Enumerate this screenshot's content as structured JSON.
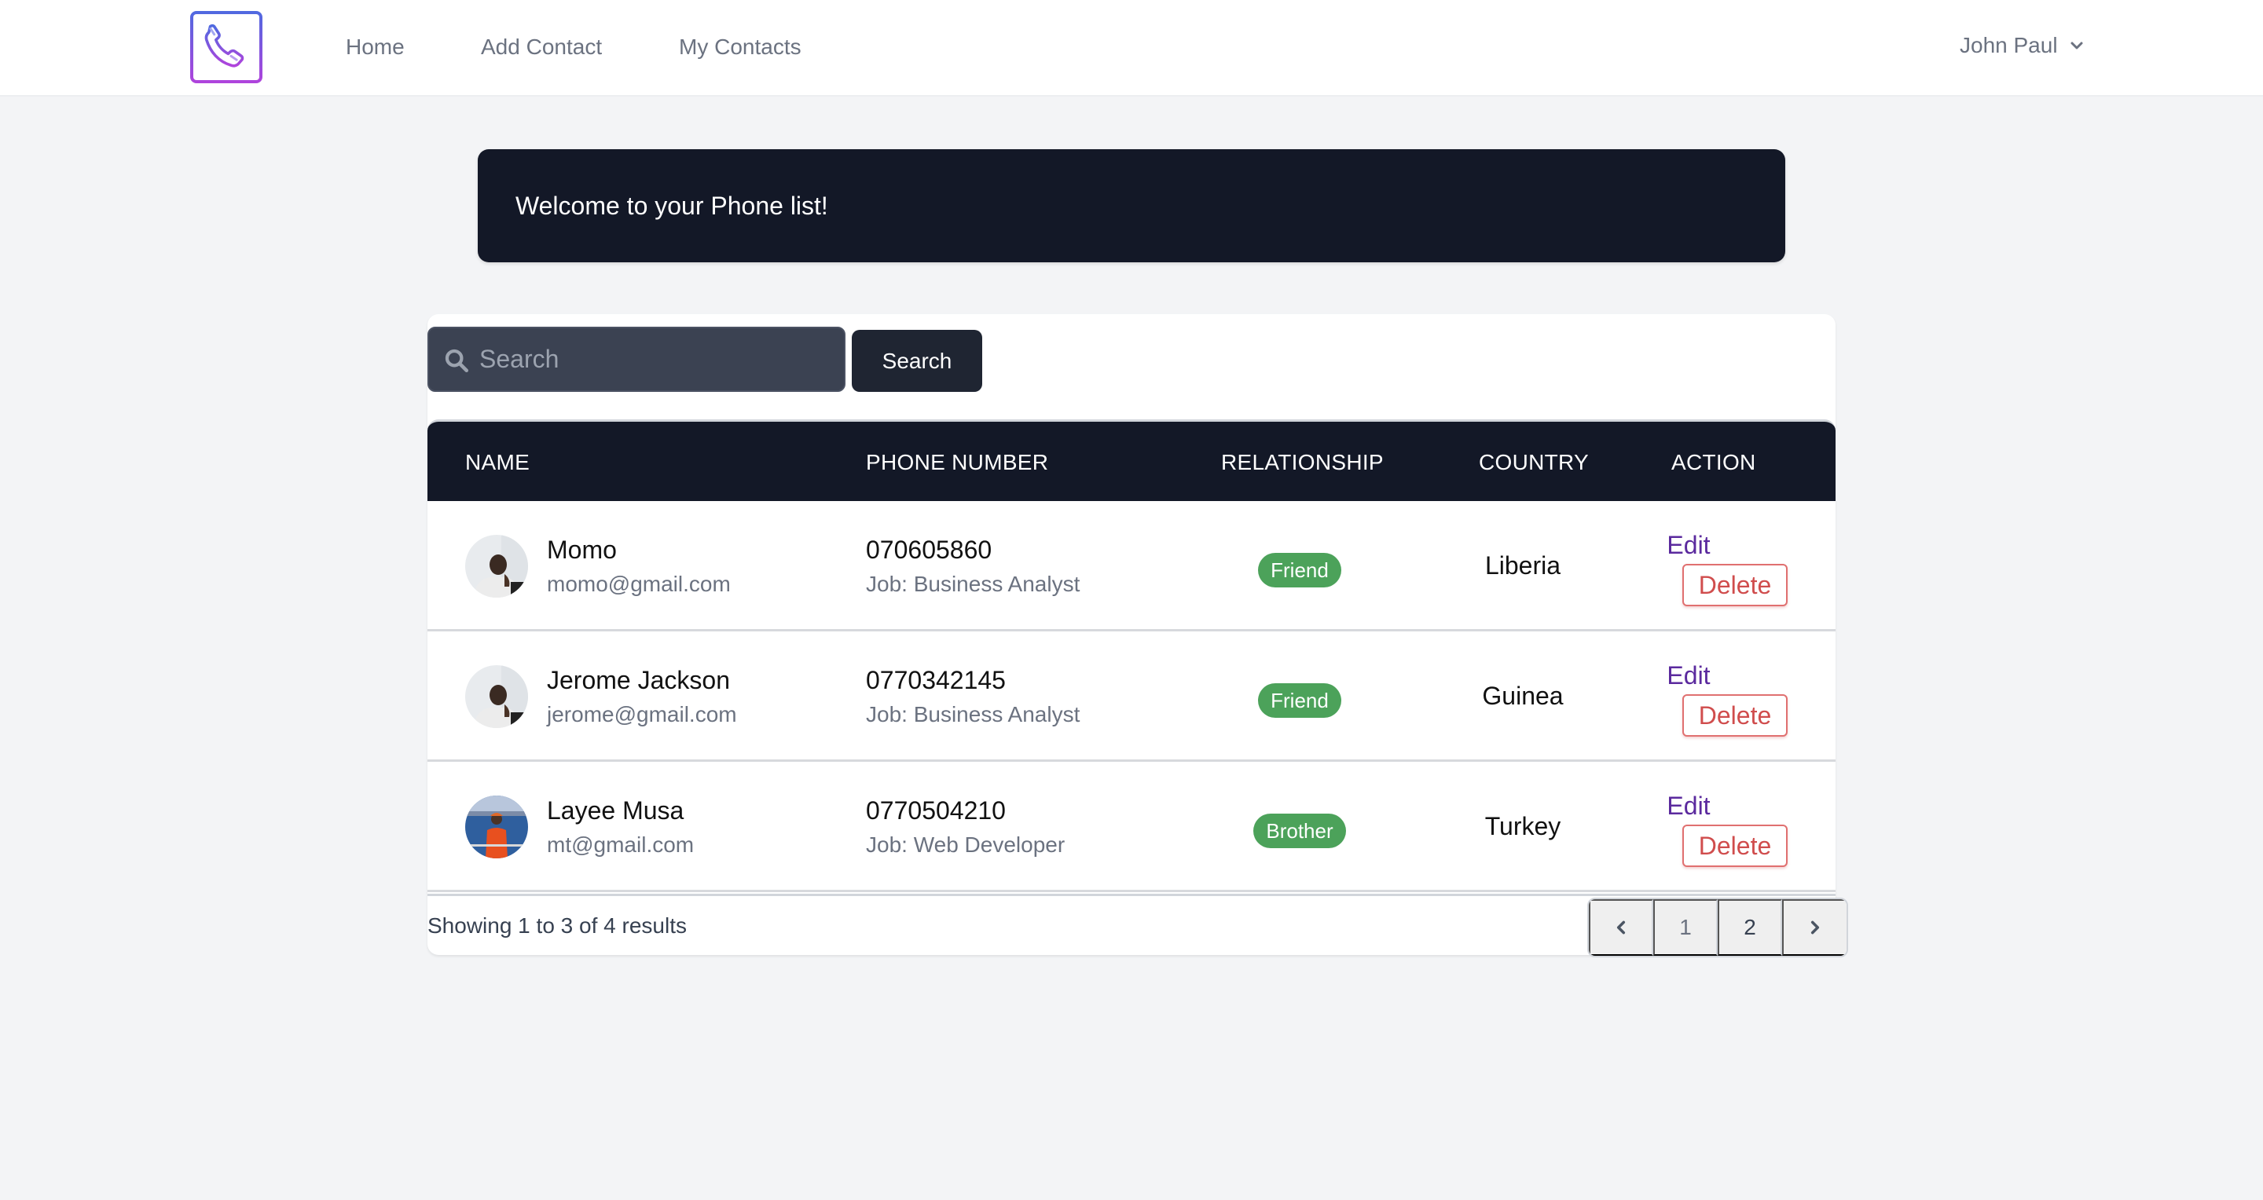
{
  "nav": {
    "logo_icon": "phone-icon",
    "links": [
      {
        "label": "Home"
      },
      {
        "label": "Add Contact"
      },
      {
        "label": "My Contacts"
      }
    ],
    "user": {
      "name": "John Paul",
      "icon": "chevron-down-icon"
    }
  },
  "banner": {
    "text": "Welcome to your Phone list!"
  },
  "search": {
    "placeholder": "Search",
    "value": "",
    "button_label": "Search",
    "icon": "search-icon"
  },
  "table": {
    "columns": [
      "NAME",
      "PHONE NUMBER",
      "RELATIONSHIP",
      "COUNTRY",
      "ACTION"
    ],
    "rows": [
      {
        "name": "Momo",
        "email": "momo@gmail.com",
        "phone": "070605860",
        "job": "Job: Business Analyst",
        "relationship": "Friend",
        "country": "Liberia",
        "edit_label": "Edit",
        "delete_label": "Delete"
      },
      {
        "name": "Jerome Jackson",
        "email": "jerome@gmail.com",
        "phone": "0770342145",
        "job": "Job: Business Analyst",
        "relationship": "Friend",
        "country": "Guinea",
        "edit_label": "Edit",
        "delete_label": "Delete"
      },
      {
        "name": "Layee Musa",
        "email": "mt@gmail.com",
        "phone": "0770504210",
        "job": "Job: Web Developer",
        "relationship": "Brother",
        "country": "Turkey",
        "edit_label": "Edit",
        "delete_label": "Delete"
      }
    ]
  },
  "footer": {
    "results_text": "Showing 1 to 3 of 4 results",
    "pages": [
      "1",
      "2"
    ],
    "current_page": "2",
    "prev_icon": "chevron-left-icon",
    "next_icon": "chevron-right-icon"
  },
  "colors": {
    "dark_bg": "#131827",
    "badge_green": "#4ca25a",
    "edit_purple": "#5b2a9e",
    "delete_red": "#d04d4d",
    "page_bg": "#f3f4f6"
  }
}
